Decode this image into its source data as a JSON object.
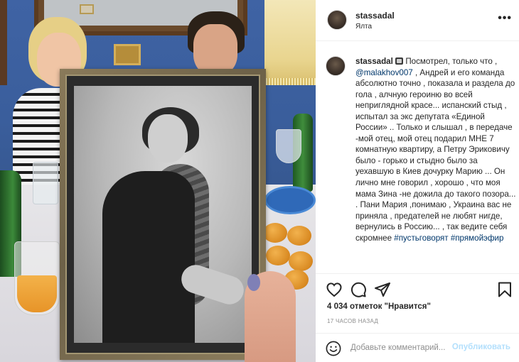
{
  "post": {
    "username": "stassadal",
    "location": "Ялта",
    "more_glyph": "•••",
    "caption_prefix": " Посмотрел, только что , ",
    "caption_mention": "@malakhov007",
    "caption_body": " , Андрей и его команда абсолютно точно , показала и раздела до гола , алчную героиню во всей неприглядной красе... испанский стыд , испытал за экс депутата «Единой России» .. Только и слышал , в передаче -мой отец, мой отец подарил МНЕ 7 комнатную квартиру, а Петру Эриковичу было - горько и стыдно было за уехавшую в Киев дочурку Марию ... Он лично мне говорил , хорошо , что моя мама Зина -не дожила до такого позора... . Пани Мария ,понимаю , Украина вас не приняла , предателей не любят нигде, вернулись в Россию... , так ведите себя скромнее ",
    "caption_hashtags": "#пустьговорят #прямойэфир",
    "likes": "4 034 отметок \"Нравится\"",
    "time_ago": "17 ЧАСОВ НАЗАД"
  },
  "composer": {
    "placeholder": "Добавьте комментарий...",
    "publish_label": "Опубликовать"
  },
  "icons": [
    "film-emoji-icon",
    "more-icon",
    "heart-icon",
    "comment-icon",
    "share-icon",
    "bookmark-icon",
    "emoji-icon"
  ],
  "colors": {
    "link": "#00376b",
    "publish_disabled": "#b2dffc",
    "muted": "#8e8e8e"
  }
}
